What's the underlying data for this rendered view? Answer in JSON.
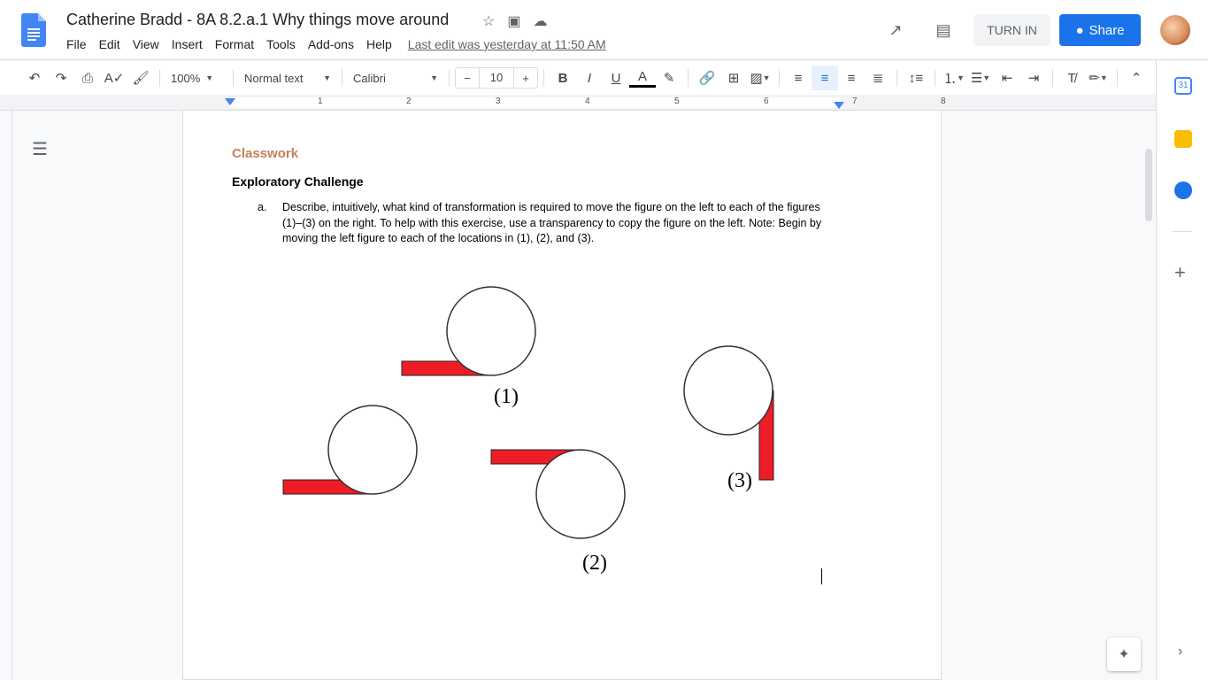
{
  "header": {
    "title": "Catherine Bradd - 8A 8.2.a.1 Why things move around",
    "menu": [
      "File",
      "Edit",
      "View",
      "Insert",
      "Format",
      "Tools",
      "Add-ons",
      "Help"
    ],
    "last_edit": "Last edit was yesterday at 11:50 AM",
    "turn_in": "TURN IN",
    "share": "Share"
  },
  "toolbar": {
    "zoom": "100%",
    "style": "Normal text",
    "font": "Calibri",
    "font_size": "10",
    "minus": "−",
    "plus": "+"
  },
  "ruler": {
    "numbers": [
      "1",
      "2",
      "3",
      "4",
      "5",
      "6",
      "7",
      "8"
    ]
  },
  "calendar_label": "31",
  "document": {
    "heading": "Classwork",
    "subheading": "Exploratory Challenge",
    "item_label": "a.",
    "item_text": "Describe, intuitively, what kind of transformation is required to move the figure on the left to each of the figures (1)–(3) on the right.  To help with this exercise, use a transparency to copy the figure on the left. Note:  Begin by moving the left figure to each of the locations in (1), (2), and (3).",
    "fig_labels": [
      "(1)",
      "(2)",
      "(3)"
    ]
  },
  "colors": {
    "accent": "#1a73e8",
    "figure_red": "#ee1c25",
    "heading": "#c0825a"
  }
}
